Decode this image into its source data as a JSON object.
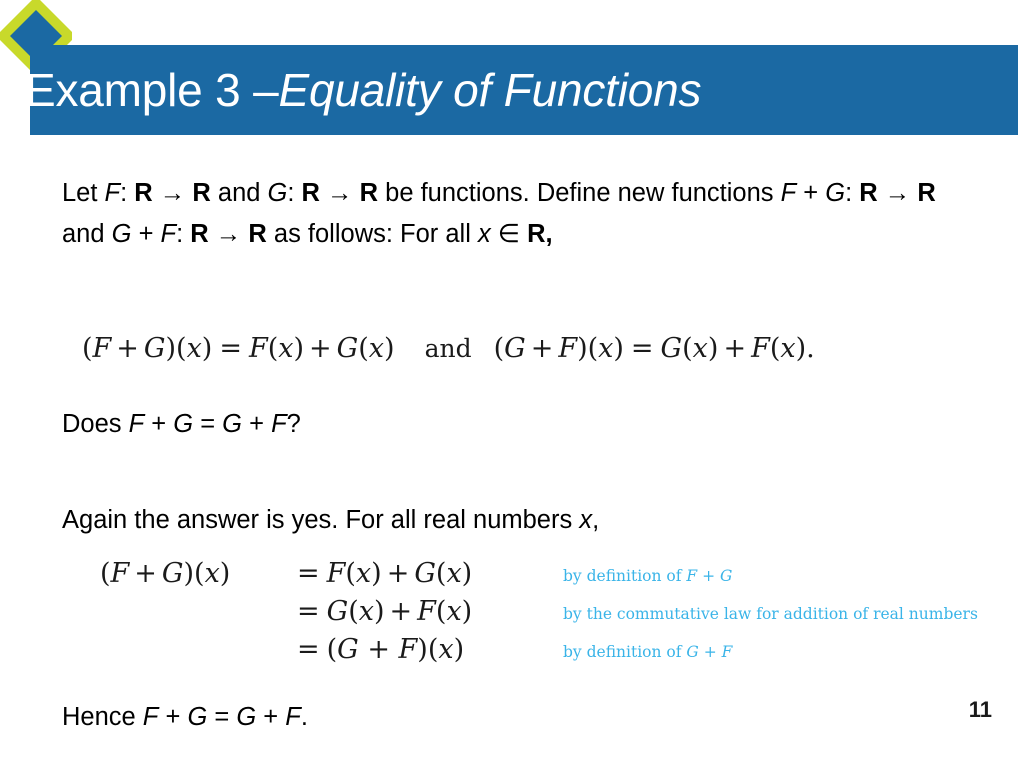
{
  "slide": {
    "title_plain": "Example 3 – ",
    "title_italic": "Equality of Functions",
    "page_number": "11",
    "accent_color": "#1b69a3",
    "diamond_outline_color": "#c8d92b",
    "diamond_fill_color": "#1b69a3",
    "reason_color": "#3ab4e8"
  },
  "body": {
    "definition": {
      "t1": "Let ",
      "f1": "F",
      "t2": ": ",
      "r1": "R",
      "arrow1": " → ",
      "r2": "R",
      "t3": " and ",
      "g1": "G",
      "t4": ": ",
      "r3": "R",
      "arrow2": " → ",
      "r4": "R",
      "t5": " be functions. Define new functions ",
      "f2": "F",
      "plus1": " + ",
      "g2": "G",
      "t6": ": ",
      "r5": "R",
      "arrow3": " → ",
      "r6": "R",
      "t7": " and ",
      "g3": "G",
      "plus2": " + ",
      "f3": "F",
      "t8": ": ",
      "r7": "R",
      "arrow4": " → ",
      "r8": "R",
      "t9": " as follows: For all ",
      "x1": "x",
      "in1": " ∈ ",
      "r9": "R,"
    },
    "does_question": {
      "t1": "Does ",
      "f1": "F",
      "plus1": " + ",
      "g1": "G",
      "eq1": " = ",
      "g2": "G",
      "plus2": " + ",
      "f2": "F",
      "t2": "?"
    },
    "again_line": {
      "t1": "Again the answer is yes. For all real numbers ",
      "x1": "x",
      "t2": ","
    },
    "hence_line": {
      "t1": "Hence ",
      "f1": "F",
      "plus1": " + ",
      "g1": "G",
      "eq1": " = ",
      "g2": "G",
      "plus2": " + ",
      "f2": "F",
      "t2": "."
    }
  },
  "display_equation": {
    "left": {
      "open": "(",
      "f": "F",
      "plus": "+",
      "g": "G",
      "close": ")(",
      "x": "x",
      "close2": ")",
      "eq": "=",
      "f2": "F",
      "xo": "(",
      "x2": "x",
      "xc": ")",
      "plus2": "+",
      "g2": "G",
      "xo2": "(",
      "x3": "x",
      "xc2": ")"
    },
    "connector": "and",
    "right": {
      "open": "(",
      "g": "G",
      "plus": "+",
      "f": "F",
      "close": ")(",
      "x": "x",
      "close2": ")",
      "eq": "=",
      "g2": "G",
      "xo": "(",
      "x2": "x",
      "xc": ")",
      "plus2": "+",
      "f2": "F",
      "xo2": "(",
      "x3": "x",
      "xc2": ")",
      "period": "."
    }
  },
  "derivation": {
    "lines": [
      {
        "lhs_open": "(",
        "lhs_a": "F",
        "lhs_plus": "+",
        "lhs_b": "G",
        "lhs_close": ")(",
        "lhs_x": "x",
        "lhs_close2": ")",
        "eq": "=",
        "rhs_a": "F",
        "rhs_xo": "(",
        "rhs_x": "x",
        "rhs_xc": ")",
        "rhs_plus": "+",
        "rhs_b": "G",
        "rhs_xo2": "(",
        "rhs_x2": "x",
        "rhs_xc2": ")",
        "reason_pre": "by definition of ",
        "reason_a": "F",
        "reason_op": " + ",
        "reason_b": "G"
      },
      {
        "lhs_open": "",
        "lhs_a": "",
        "lhs_plus": "",
        "lhs_b": "",
        "lhs_close": "",
        "lhs_x": "",
        "lhs_close2": "",
        "eq": "=",
        "rhs_a": "G",
        "rhs_xo": "(",
        "rhs_x": "x",
        "rhs_xc": ")",
        "rhs_plus": "+",
        "rhs_b": "F",
        "rhs_xo2": "(",
        "rhs_x2": "x",
        "rhs_xc2": ")",
        "reason_pre": "by the commutative law for addition of real numbers",
        "reason_a": "",
        "reason_op": "",
        "reason_b": ""
      },
      {
        "lhs_open": "",
        "lhs_a": "",
        "lhs_plus": "",
        "lhs_b": "",
        "lhs_close": "",
        "lhs_x": "",
        "lhs_close2": "",
        "eq": "=",
        "rhs_a": "(",
        "rhs_xo": "G",
        "rhs_x": " + ",
        "rhs_xc": "F",
        "rhs_plus": ")(",
        "rhs_b": "x",
        "rhs_xo2": ")",
        "rhs_x2": "",
        "rhs_xc2": "",
        "reason_pre": "by definition of ",
        "reason_a": "G",
        "reason_op": " + ",
        "reason_b": "F"
      }
    ]
  }
}
